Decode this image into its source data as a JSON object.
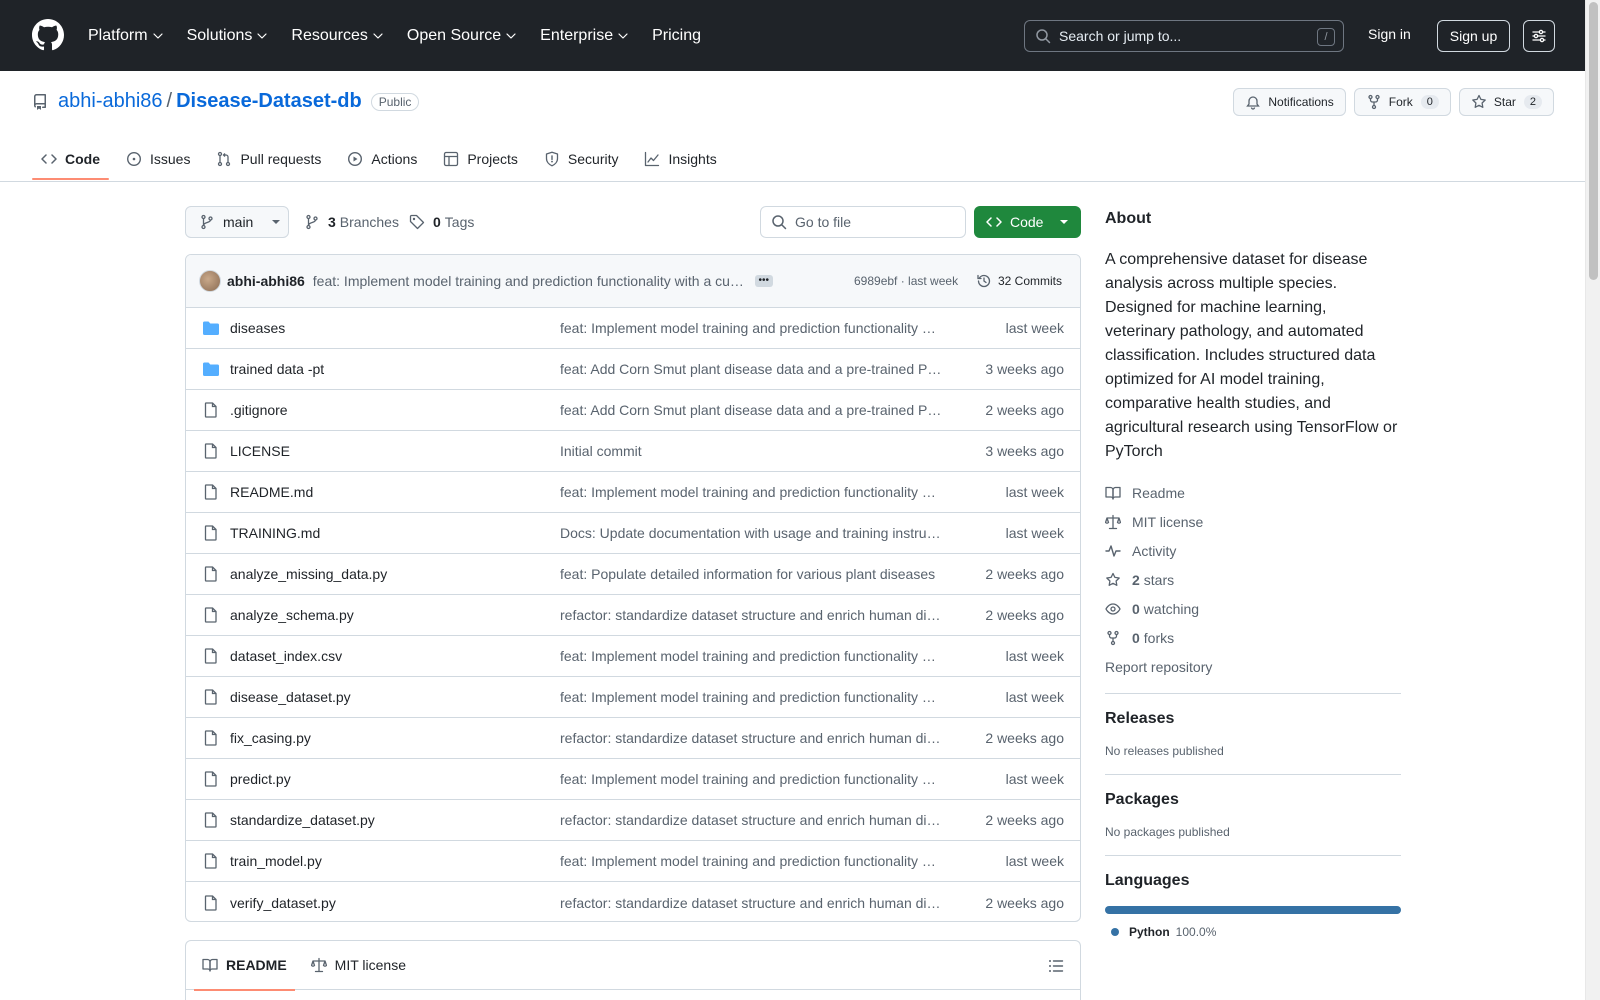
{
  "header": {
    "nav": [
      {
        "label": "Platform",
        "dropdown": true
      },
      {
        "label": "Solutions",
        "dropdown": true
      },
      {
        "label": "Resources",
        "dropdown": true
      },
      {
        "label": "Open Source",
        "dropdown": true
      },
      {
        "label": "Enterprise",
        "dropdown": true
      },
      {
        "label": "Pricing",
        "dropdown": false
      }
    ],
    "search_placeholder": "Search or jump to...",
    "search_shortcut": "/",
    "signin": "Sign in",
    "signup": "Sign up"
  },
  "repo": {
    "owner": "abhi-abhi86",
    "separator": "/",
    "name": "Disease-Dataset-db",
    "visibility": "Public",
    "notifications": "Notifications",
    "fork_label": "Fork",
    "fork_count": "0",
    "star_label": "Star",
    "star_count": "2"
  },
  "tabs": [
    {
      "label": "Code",
      "icon": "code-icon",
      "active": true
    },
    {
      "label": "Issues",
      "icon": "issue-icon",
      "active": false
    },
    {
      "label": "Pull requests",
      "icon": "pull-request-icon",
      "active": false
    },
    {
      "label": "Actions",
      "icon": "play-icon",
      "active": false
    },
    {
      "label": "Projects",
      "icon": "table-icon",
      "active": false
    },
    {
      "label": "Security",
      "icon": "shield-icon",
      "active": false
    },
    {
      "label": "Insights",
      "icon": "graph-icon",
      "active": false
    }
  ],
  "browser": {
    "branch": "main",
    "branches_count": "3",
    "branches_label": "Branches",
    "tags_count": "0",
    "tags_label": "Tags",
    "goto_placeholder": "Go to file",
    "code_button": "Code"
  },
  "latest_commit": {
    "author": "abhi-abhi86",
    "message": "feat: Implement model training and prediction functionality with a custom model",
    "hash_time": "6989ebf · last week",
    "commits": "32 Commits"
  },
  "files": [
    {
      "type": "folder",
      "name": "diseases",
      "commit": "feat: Implement model training and prediction functionality with a custom model",
      "age": "last week"
    },
    {
      "type": "folder",
      "name": "trained data -pt",
      "commit": "feat: Add Corn Smut plant disease data and a pre-trained PyTorch model",
      "age": "3 weeks ago"
    },
    {
      "type": "file",
      "name": ".gitignore",
      "commit": "feat: Add Corn Smut plant disease data and a pre-trained PyTorch model",
      "age": "2 weeks ago"
    },
    {
      "type": "file",
      "name": "LICENSE",
      "commit": "Initial commit",
      "age": "3 weeks ago"
    },
    {
      "type": "file",
      "name": "README.md",
      "commit": "feat: Implement model training and prediction functionality with a custom model",
      "age": "last week"
    },
    {
      "type": "file",
      "name": "TRAINING.md",
      "commit": "Docs: Update documentation with usage and training instructions",
      "age": "last week"
    },
    {
      "type": "file",
      "name": "analyze_missing_data.py",
      "commit": "feat: Populate detailed information for various plant diseases",
      "age": "2 weeks ago"
    },
    {
      "type": "file",
      "name": "analyze_schema.py",
      "commit": "refactor: standardize dataset structure and enrich human disease data",
      "age": "2 weeks ago"
    },
    {
      "type": "file",
      "name": "dataset_index.csv",
      "commit": "feat: Implement model training and prediction functionality with a custom model",
      "age": "last week"
    },
    {
      "type": "file",
      "name": "disease_dataset.py",
      "commit": "feat: Implement model training and prediction functionality with a custom model",
      "age": "last week"
    },
    {
      "type": "file",
      "name": "fix_casing.py",
      "commit": "refactor: standardize dataset structure and enrich human disease data",
      "age": "2 weeks ago"
    },
    {
      "type": "file",
      "name": "predict.py",
      "commit": "feat: Implement model training and prediction functionality with a custom model",
      "age": "last week"
    },
    {
      "type": "file",
      "name": "standardize_dataset.py",
      "commit": "refactor: standardize dataset structure and enrich human disease data",
      "age": "2 weeks ago"
    },
    {
      "type": "file",
      "name": "train_model.py",
      "commit": "feat: Implement model training and prediction functionality with a custom model",
      "age": "last week"
    },
    {
      "type": "file",
      "name": "verify_dataset.py",
      "commit": "refactor: standardize dataset structure and enrich human disease data",
      "age": "2 weeks ago"
    }
  ],
  "readme_tabs": [
    {
      "label": "README",
      "icon": "book-icon",
      "active": true
    },
    {
      "label": "MIT license",
      "icon": "law-icon",
      "active": false
    }
  ],
  "sidebar": {
    "about_title": "About",
    "about_text": "A comprehensive dataset for disease analysis across multiple species. Designed for machine learning, veterinary pathology, and automated classification. Includes structured data optimized for AI model training, comparative health studies, and agricultural research using TensorFlow or PyTorch",
    "links": [
      {
        "icon": "book-icon",
        "count": "",
        "label": "Readme"
      },
      {
        "icon": "law-icon",
        "count": "",
        "label": "MIT license"
      },
      {
        "icon": "pulse-icon",
        "count": "",
        "label": "Activity"
      },
      {
        "icon": "star-icon",
        "count": "2",
        "label": "stars"
      },
      {
        "icon": "eye-icon",
        "count": "0",
        "label": "watching"
      },
      {
        "icon": "fork-icon",
        "count": "0",
        "label": "forks"
      }
    ],
    "report": "Report repository",
    "releases_title": "Releases",
    "releases_text": "No releases published",
    "packages_title": "Packages",
    "packages_text": "No packages published",
    "languages_title": "Languages",
    "language": {
      "name": "Python",
      "percent": "100.0%",
      "fraction": 1.0,
      "color": "#3572a5"
    }
  },
  "colors": {
    "header_bg": "#1f2328",
    "link": "#0969da",
    "primary_button": "#1f883d",
    "tab_underline": "#fd8c73",
    "folder": "#54aeff"
  }
}
